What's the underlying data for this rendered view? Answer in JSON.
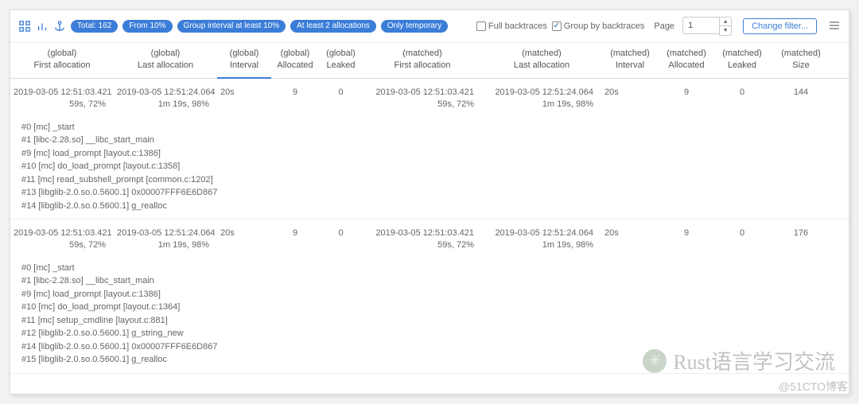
{
  "toolbar": {
    "badges": [
      "Total: 162",
      "From 10%",
      "Group interval at least 10%",
      "At least 2 allocations",
      "Only temporary"
    ],
    "full_backtraces_label": "Full backtraces",
    "full_backtraces_checked": false,
    "group_by_label": "Group by backtraces",
    "group_by_checked": true,
    "page_label": "Page",
    "page_value": "1",
    "filter_button": "Change filter..."
  },
  "columns": [
    {
      "group": "(global)",
      "label": "First allocation"
    },
    {
      "group": "(global)",
      "label": "Last allocation"
    },
    {
      "group": "(global)",
      "label": "Interval",
      "sorted": true
    },
    {
      "group": "(global)",
      "label": "Allocated"
    },
    {
      "group": "(global)",
      "label": "Leaked"
    },
    {
      "group": "(matched)",
      "label": "First allocation"
    },
    {
      "group": "(matched)",
      "label": "Last allocation"
    },
    {
      "group": "(matched)",
      "label": "Interval"
    },
    {
      "group": "(matched)",
      "label": "Allocated"
    },
    {
      "group": "(matched)",
      "label": "Leaked"
    },
    {
      "group": "(matched)",
      "label": "Size"
    }
  ],
  "rows": [
    {
      "g_first_a": "2019-03-05 12:51:03.421",
      "g_first_b": "59s, 72%",
      "g_last_a": "2019-03-05 12:51:24.064",
      "g_last_b": "1m 19s, 98%",
      "g_interval": "20s",
      "g_alloc": "9",
      "g_leaked": "0",
      "m_first_a": "2019-03-05 12:51:03.421",
      "m_first_b": "59s, 72%",
      "m_last_a": "2019-03-05 12:51:24.064",
      "m_last_b": "1m 19s, 98%",
      "m_interval": "20s",
      "m_alloc": "9",
      "m_leaked": "0",
      "m_size": "144",
      "stack": [
        "#0 [mc] _start",
        "#1 [libc-2.28.so] __libc_start_main",
        "#9 [mc] load_prompt [layout.c:1386]",
        "#10 [mc] do_load_prompt [layout.c:1358]",
        "#11 [mc] read_subshell_prompt [common.c:1202]",
        "#13 [libglib-2.0.so.0.5600.1] 0x00007FFF6E6D867",
        "#14 [libglib-2.0.so.0.5600.1] g_realloc"
      ]
    },
    {
      "g_first_a": "2019-03-05 12:51:03.421",
      "g_first_b": "59s, 72%",
      "g_last_a": "2019-03-05 12:51:24.064",
      "g_last_b": "1m 19s, 98%",
      "g_interval": "20s",
      "g_alloc": "9",
      "g_leaked": "0",
      "m_first_a": "2019-03-05 12:51:03.421",
      "m_first_b": "59s, 72%",
      "m_last_a": "2019-03-05 12:51:24.064",
      "m_last_b": "1m 19s, 98%",
      "m_interval": "20s",
      "m_alloc": "9",
      "m_leaked": "0",
      "m_size": "176",
      "stack": [
        "#0 [mc] _start",
        "#1 [libc-2.28.so] __libc_start_main",
        "#9 [mc] load_prompt [layout.c:1386]",
        "#10 [mc] do_load_prompt [layout.c:1364]",
        "#11 [mc] setup_cmdline [layout.c:881]",
        "#12 [libglib-2.0.so.0.5600.1] g_string_new",
        "#14 [libglib-2.0.so.0.5600.1] 0x00007FFF6E6D867",
        "#15 [libglib-2.0.so.0.5600.1] g_realloc"
      ]
    }
  ],
  "watermark1": "Rust语言学习交流",
  "watermark2": "@51CTO博客"
}
